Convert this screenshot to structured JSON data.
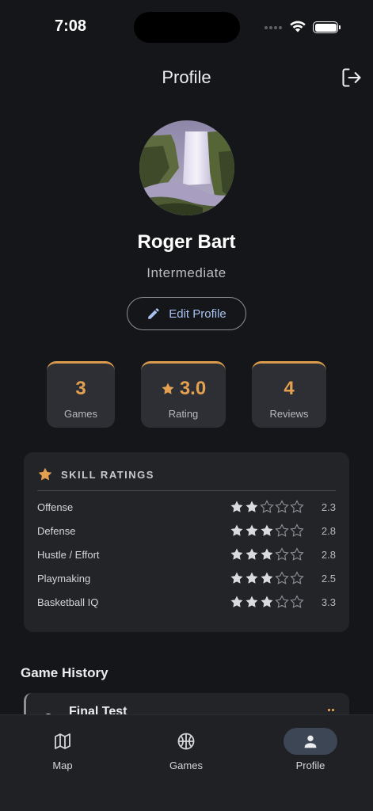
{
  "status_bar": {
    "time": "7:08"
  },
  "header": {
    "title": "Profile",
    "logout_icon": "logout-icon"
  },
  "profile": {
    "name": "Roger Bart",
    "level": "Intermediate",
    "edit_label": "Edit Profile"
  },
  "stats": [
    {
      "value": "3",
      "label": "Games"
    },
    {
      "value": "3.0",
      "label": "Rating",
      "icon": "star-icon"
    },
    {
      "value": "4",
      "label": "Reviews"
    }
  ],
  "skills": {
    "title": "SKILL RATINGS",
    "items": [
      {
        "name": "Offense",
        "stars": 2,
        "score": "2.3"
      },
      {
        "name": "Defense",
        "stars": 3,
        "score": "2.8"
      },
      {
        "name": "Hustle / Effort",
        "stars": 3,
        "score": "2.8"
      },
      {
        "name": "Playmaking",
        "stars": 3,
        "score": "2.5"
      },
      {
        "name": "Basketball IQ",
        "stars": 3,
        "score": "3.3"
      }
    ]
  },
  "history": {
    "title": "Game History",
    "items": [
      {
        "title": "Final Test"
      }
    ]
  },
  "tabs": [
    {
      "label": "Map",
      "icon": "map-icon",
      "active": false
    },
    {
      "label": "Games",
      "icon": "basketball-icon",
      "active": false
    },
    {
      "label": "Profile",
      "icon": "person-icon",
      "active": true
    }
  ],
  "colors": {
    "accent": "#E3A051",
    "background": "#151619",
    "card": "#2D2F34",
    "link": "#A9C2F0"
  }
}
